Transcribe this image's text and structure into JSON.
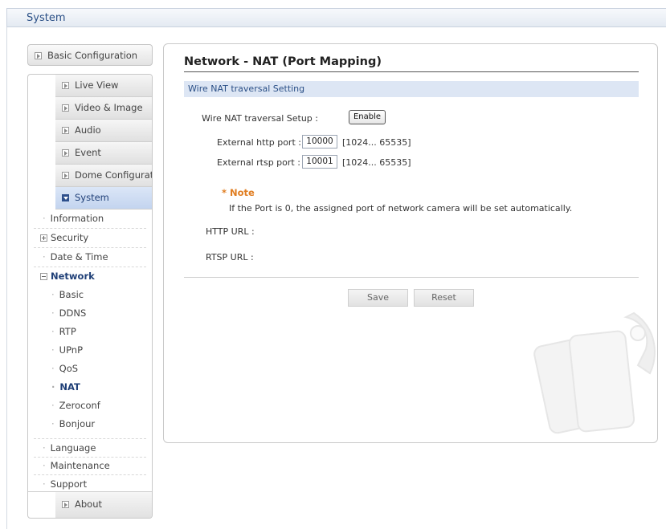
{
  "header": {
    "title": "System"
  },
  "sidebar": {
    "basic_configuration": "Basic Configuration",
    "main_items": [
      "Live View",
      "Video & Image",
      "Audio",
      "Event",
      "Dome Configuration",
      "System"
    ],
    "system_items": {
      "information": "Information",
      "security": "Security",
      "date_time": "Date & Time",
      "network": "Network",
      "network_children": [
        "Basic",
        "DDNS",
        "RTP",
        "UPnP",
        "QoS",
        "NAT",
        "Zeroconf",
        "Bonjour"
      ],
      "language": "Language",
      "maintenance": "Maintenance",
      "support": "Support"
    },
    "about": "About",
    "active_item": "NAT"
  },
  "main": {
    "title": "Network - NAT (Port Mapping)",
    "section": "Wire NAT traversal Setting",
    "setup_label": "Wire NAT traversal Setup :",
    "enable_button": "Enable",
    "http_port": {
      "label": "External http port :",
      "value": "10000",
      "range": "[1024... 65535]"
    },
    "rtsp_port": {
      "label": "External rtsp port :",
      "value": "10001",
      "range": "[1024... 65535]"
    },
    "note_title": "* Note",
    "note_text": "If the Port is 0, the assigned port of network camera will be set automatically.",
    "http_url_label": "HTTP URL :",
    "rtsp_url_label": "RTSP URL :",
    "save_button": "Save",
    "reset_button": "Reset"
  },
  "colors": {
    "accent": "#2a4f86",
    "note": "#e07d20",
    "section_bg": "#dde6f4"
  }
}
